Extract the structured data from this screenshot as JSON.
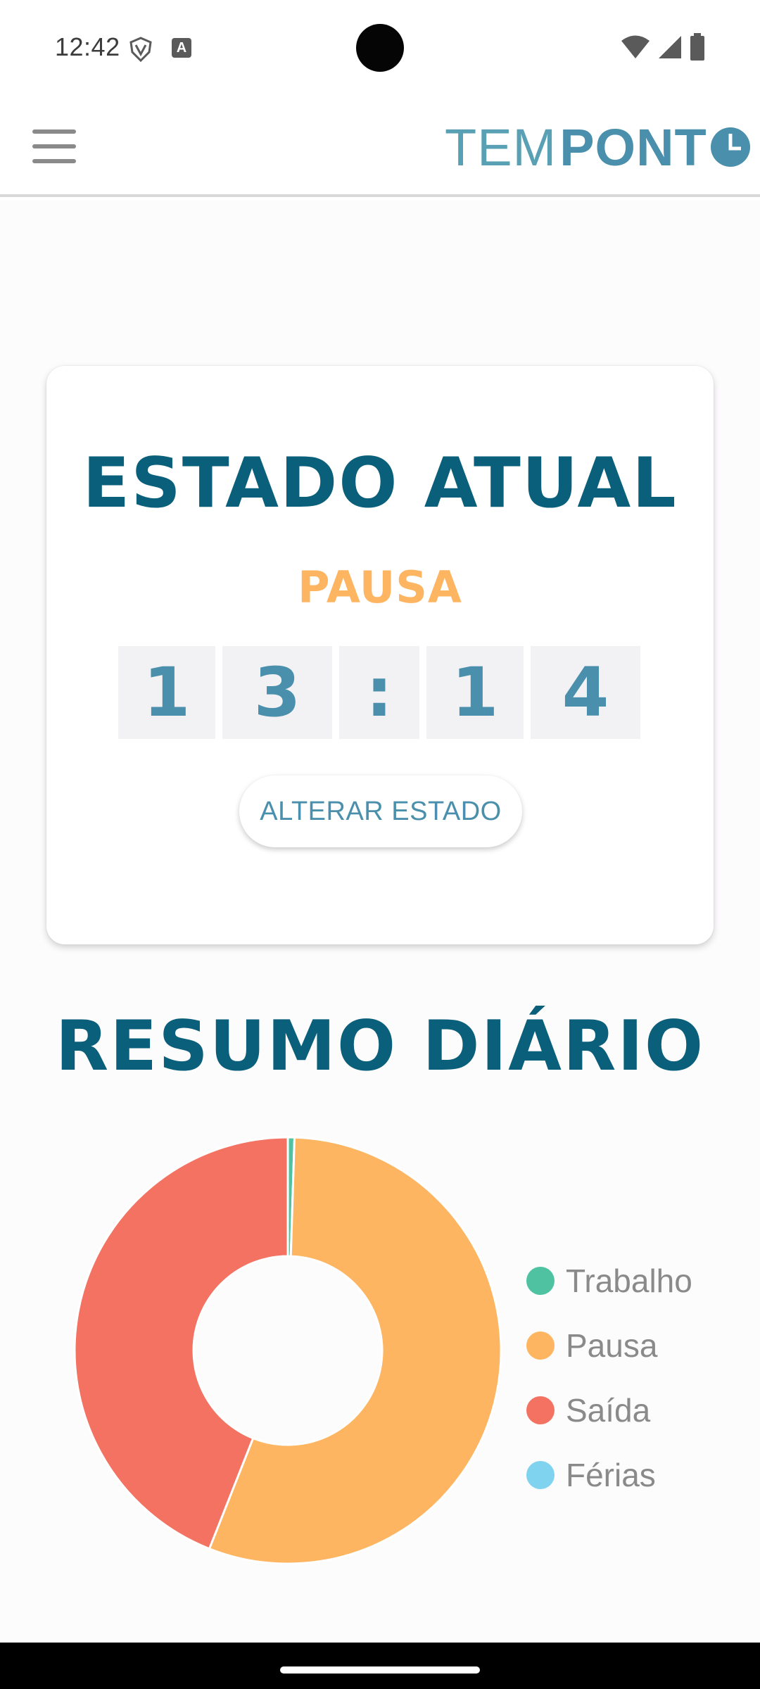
{
  "status_bar": {
    "time": "12:42",
    "icons": [
      "shield-icon",
      "font-a-icon",
      "wifi-icon",
      "signal-icon",
      "battery-icon"
    ]
  },
  "app_bar": {
    "menu_icon": "hamburger-menu-icon",
    "logo_light": "TEM",
    "logo_bold": "PONT",
    "logo_clock_icon": "clock-icon",
    "colors": {
      "light": "#5aa0b4",
      "bold": "#4a8fab"
    }
  },
  "state_card": {
    "title": "ESTADO ATUAL",
    "state": "PAUSA",
    "timer": {
      "d1": "1",
      "d2": "3",
      "sep": ":",
      "d3": "1",
      "d4": "4"
    },
    "button_label": "ALTERAR ESTADO"
  },
  "summary": {
    "title": "RESUMO DIÁRIO"
  },
  "chart_data": {
    "type": "pie",
    "donut": true,
    "categories": [
      "Trabalho",
      "Pausa",
      "Saída",
      "Férias"
    ],
    "values": [
      0.5,
      55.5,
      44,
      0
    ],
    "colors": [
      "#4fc3a1",
      "#fdb562",
      "#f47262",
      "#7fd3ee"
    ],
    "legend_position": "right"
  },
  "colors": {
    "title": "#0a5f7a",
    "accent": "#4a8fab",
    "state": "#fdb562"
  }
}
